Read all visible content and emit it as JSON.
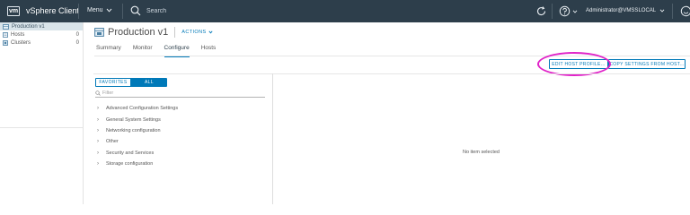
{
  "app": {
    "logo": "vm",
    "title": "vSphere Client"
  },
  "topbar": {
    "menu_label": "Menu",
    "search_placeholder": "Search",
    "user_label": "Administrator@VMSSLOCAL"
  },
  "navigator": {
    "items": [
      {
        "label": "Production v1",
        "icon": "datacenter-icon"
      },
      {
        "label": "Hosts",
        "count": "0",
        "icon": "host-icon"
      },
      {
        "label": "Clusters",
        "count": "0",
        "icon": "cluster-icon"
      }
    ]
  },
  "header": {
    "title": "Production v1",
    "actions_label": "ACTIONS"
  },
  "tabs": [
    {
      "label": "Summary"
    },
    {
      "label": "Monitor"
    },
    {
      "label": "Configure",
      "active": true
    },
    {
      "label": "Hosts"
    }
  ],
  "toolbar": {
    "edit_label": "EDIT HOST PROFILE...",
    "copy_label": "COPY SETTINGS FROM HOST..."
  },
  "settings_panel": {
    "favorites_label": "FAVORITES",
    "all_label": "ALL",
    "filter_placeholder": "Filter",
    "items": [
      "Advanced Configuration Settings",
      "General System Settings",
      "Networking configuration",
      "Other",
      "Security and Services",
      "Storage configuration"
    ]
  },
  "details": {
    "empty_text": "No item selected"
  },
  "colors": {
    "topbar": "#2d3e4b",
    "accent": "#0079b8",
    "annotation": "#e022c8"
  }
}
